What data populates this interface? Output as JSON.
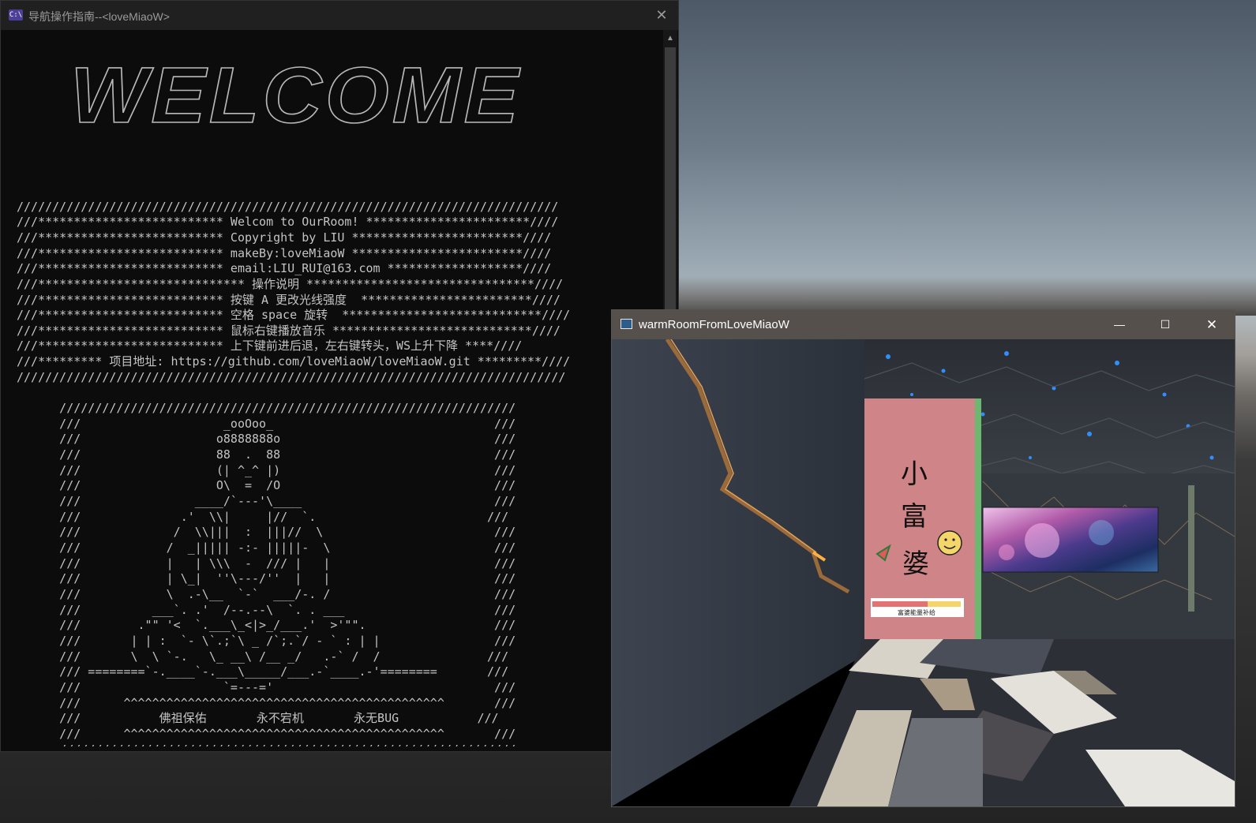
{
  "console_window": {
    "title": "导航操作指南--<loveMiaoW>",
    "icon": "console-app-icon",
    "icon_text": "C:\\",
    "close_glyph": "✕",
    "scroll_up_glyph": "▲",
    "lines": [
      "",
      "",
      "",
      "",
      "",
      "",
      "",
      "",
      "",
      "",
      "////////////////////////////////////////////////////////////////////////////",
      "///************************** Welcom to OurRoom! ***********************////",
      "///************************** Copyright by LIU ************************////",
      "///************************** makeBy:loveMiaoW ************************////",
      "///************************** email:LIU_RUI@163.com *******************////",
      "///***************************** 操作说明 ********************************////",
      "///************************** 按键 A 更改光线强度  ************************////",
      "///************************** 空格 space 旋转  ****************************////",
      "///************************** 鼠标右键播放音乐 ****************************////",
      "///************************** 上下键前进后退，左右键转头，WS上升下降 ****////",
      "///********* 项目地址: https://github.com/loveMiaoW/loveMiaoW.git *********////",
      "/////////////////////////////////////////////////////////////////////////////",
      "",
      "      ////////////////////////////////////////////////////////////////",
      "      ///                    _ooOoo_                               ///",
      "      ///                   o8888888o                              ///",
      "      ///                   88  .  88                              ///",
      "      ///                   (| ^_^ |)                              ///",
      "      ///                   O\\  =  /O                              ///",
      "      ///                ____/`---'\\____                           ///",
      "      ///              .'  \\\\|     |//  `.                        ///",
      "      ///             /  \\\\|||  :  |||//  \\                        ///",
      "      ///            /  _||||| -:- |||||-  \\                       ///",
      "      ///            |   | \\\\\\  -  /// |   |                       ///",
      "      ///            | \\_|  ''\\---/''  |   |                       ///",
      "      ///            \\  .-\\__  `-`  ___/-. /                       ///",
      "      ///          ___`. .'  /--.--\\  `. . ___                     ///",
      "      ///        .\"\" '<  `.___\\_<|>_/___.'  >'\"\".                  ///",
      "      ///       | | :  `- \\`.;`\\ _ /`;.`/ - ` : | |                ///",
      "      ///       \\  \\ `-.   \\_ __\\ /__ _/   .-` /  /               ///",
      "      /// ========`-.____`-.___\\_____/___.-`____.-'========       ///",
      "      ///                    `=---='                               ///",
      "      ///      ^^^^^^^^^^^^^^^^^^^^^^^^^^^^^^^^^^^^^^^^^^^^^       ///",
      "      ///           佛祖保佑       永不宕机       永无BUG           ///",
      "      ///      ^^^^^^^^^^^^^^^^^^^^^^^^^^^^^^^^^^^^^^^^^^^^^       ///",
      "      ////////////////////////////////////////////////////////////////"
    ],
    "banner_text": "WELCOME"
  },
  "room_window": {
    "title": "warmRoomFromLoveMiaoW",
    "icon": "room-app-icon",
    "minimize_glyph": "—",
    "maximize_glyph": "☐",
    "close_glyph": "✕",
    "scene": {
      "poster_chars": [
        "小",
        "富",
        "婆"
      ],
      "poster_caption": "富婆能量补给",
      "poster_color": "#cf8587",
      "accent_green": "#6cb870",
      "smiley_icon": "smiley-icon",
      "watermelon_icon": "watermelon-icon",
      "painting": "galaxy-painting"
    }
  }
}
